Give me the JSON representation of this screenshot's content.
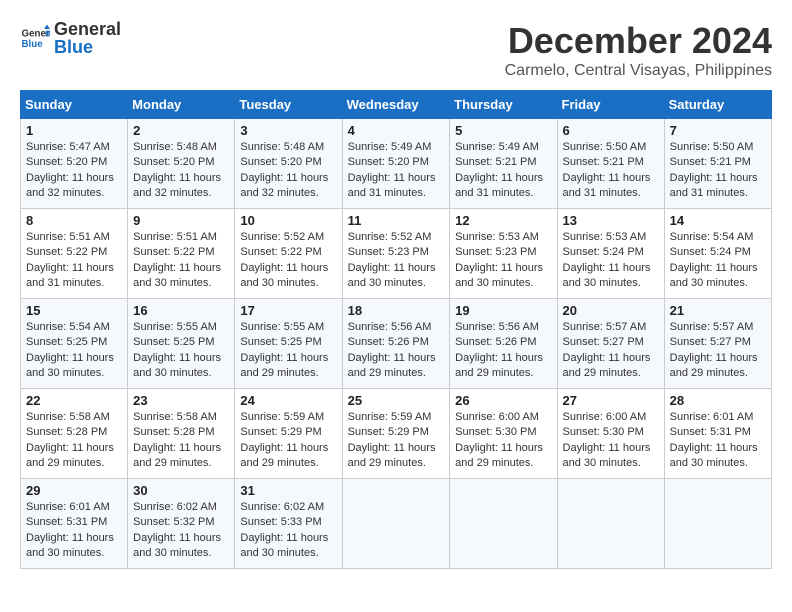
{
  "logo": {
    "text_general": "General",
    "text_blue": "Blue"
  },
  "title": {
    "month": "December 2024",
    "location": "Carmelo, Central Visayas, Philippines"
  },
  "headers": [
    "Sunday",
    "Monday",
    "Tuesday",
    "Wednesday",
    "Thursday",
    "Friday",
    "Saturday"
  ],
  "weeks": [
    [
      {
        "day": "1",
        "sunrise": "5:47 AM",
        "sunset": "5:20 PM",
        "daylight": "11 hours and 32 minutes."
      },
      {
        "day": "2",
        "sunrise": "5:48 AM",
        "sunset": "5:20 PM",
        "daylight": "11 hours and 32 minutes."
      },
      {
        "day": "3",
        "sunrise": "5:48 AM",
        "sunset": "5:20 PM",
        "daylight": "11 hours and 32 minutes."
      },
      {
        "day": "4",
        "sunrise": "5:49 AM",
        "sunset": "5:20 PM",
        "daylight": "11 hours and 31 minutes."
      },
      {
        "day": "5",
        "sunrise": "5:49 AM",
        "sunset": "5:21 PM",
        "daylight": "11 hours and 31 minutes."
      },
      {
        "day": "6",
        "sunrise": "5:50 AM",
        "sunset": "5:21 PM",
        "daylight": "11 hours and 31 minutes."
      },
      {
        "day": "7",
        "sunrise": "5:50 AM",
        "sunset": "5:21 PM",
        "daylight": "11 hours and 31 minutes."
      }
    ],
    [
      {
        "day": "8",
        "sunrise": "5:51 AM",
        "sunset": "5:22 PM",
        "daylight": "11 hours and 31 minutes."
      },
      {
        "day": "9",
        "sunrise": "5:51 AM",
        "sunset": "5:22 PM",
        "daylight": "11 hours and 30 minutes."
      },
      {
        "day": "10",
        "sunrise": "5:52 AM",
        "sunset": "5:22 PM",
        "daylight": "11 hours and 30 minutes."
      },
      {
        "day": "11",
        "sunrise": "5:52 AM",
        "sunset": "5:23 PM",
        "daylight": "11 hours and 30 minutes."
      },
      {
        "day": "12",
        "sunrise": "5:53 AM",
        "sunset": "5:23 PM",
        "daylight": "11 hours and 30 minutes."
      },
      {
        "day": "13",
        "sunrise": "5:53 AM",
        "sunset": "5:24 PM",
        "daylight": "11 hours and 30 minutes."
      },
      {
        "day": "14",
        "sunrise": "5:54 AM",
        "sunset": "5:24 PM",
        "daylight": "11 hours and 30 minutes."
      }
    ],
    [
      {
        "day": "15",
        "sunrise": "5:54 AM",
        "sunset": "5:25 PM",
        "daylight": "11 hours and 30 minutes."
      },
      {
        "day": "16",
        "sunrise": "5:55 AM",
        "sunset": "5:25 PM",
        "daylight": "11 hours and 30 minutes."
      },
      {
        "day": "17",
        "sunrise": "5:55 AM",
        "sunset": "5:25 PM",
        "daylight": "11 hours and 29 minutes."
      },
      {
        "day": "18",
        "sunrise": "5:56 AM",
        "sunset": "5:26 PM",
        "daylight": "11 hours and 29 minutes."
      },
      {
        "day": "19",
        "sunrise": "5:56 AM",
        "sunset": "5:26 PM",
        "daylight": "11 hours and 29 minutes."
      },
      {
        "day": "20",
        "sunrise": "5:57 AM",
        "sunset": "5:27 PM",
        "daylight": "11 hours and 29 minutes."
      },
      {
        "day": "21",
        "sunrise": "5:57 AM",
        "sunset": "5:27 PM",
        "daylight": "11 hours and 29 minutes."
      }
    ],
    [
      {
        "day": "22",
        "sunrise": "5:58 AM",
        "sunset": "5:28 PM",
        "daylight": "11 hours and 29 minutes."
      },
      {
        "day": "23",
        "sunrise": "5:58 AM",
        "sunset": "5:28 PM",
        "daylight": "11 hours and 29 minutes."
      },
      {
        "day": "24",
        "sunrise": "5:59 AM",
        "sunset": "5:29 PM",
        "daylight": "11 hours and 29 minutes."
      },
      {
        "day": "25",
        "sunrise": "5:59 AM",
        "sunset": "5:29 PM",
        "daylight": "11 hours and 29 minutes."
      },
      {
        "day": "26",
        "sunrise": "6:00 AM",
        "sunset": "5:30 PM",
        "daylight": "11 hours and 29 minutes."
      },
      {
        "day": "27",
        "sunrise": "6:00 AM",
        "sunset": "5:30 PM",
        "daylight": "11 hours and 30 minutes."
      },
      {
        "day": "28",
        "sunrise": "6:01 AM",
        "sunset": "5:31 PM",
        "daylight": "11 hours and 30 minutes."
      }
    ],
    [
      {
        "day": "29",
        "sunrise": "6:01 AM",
        "sunset": "5:31 PM",
        "daylight": "11 hours and 30 minutes."
      },
      {
        "day": "30",
        "sunrise": "6:02 AM",
        "sunset": "5:32 PM",
        "daylight": "11 hours and 30 minutes."
      },
      {
        "day": "31",
        "sunrise": "6:02 AM",
        "sunset": "5:33 PM",
        "daylight": "11 hours and 30 minutes."
      },
      null,
      null,
      null,
      null
    ]
  ]
}
